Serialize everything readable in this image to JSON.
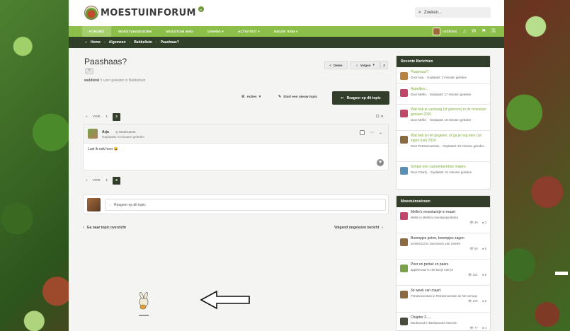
{
  "brand": {
    "name": "MOESTUINFORUM",
    "badge": "nl"
  },
  "search": {
    "placeholder": "Zoeken..."
  },
  "nav": {
    "items": [
      "FORUMS",
      "MOESTUINSEIZOEN",
      "MOESTUIN WIKI",
      "OVERIG",
      "ACTIVITEIT",
      "NIEUW ITEM"
    ],
    "user": "roddebra"
  },
  "breadcrumb": [
    "Home",
    "Algemeen",
    "Babbeltuin",
    "Paashaas?"
  ],
  "thread": {
    "title": "Paashaas?",
    "tag_button": "+",
    "author": "woldistel",
    "meta_rest": "5 uren geleden in Babbeltuin",
    "share": "Delen",
    "follow": "Volgen",
    "follow_count": "2",
    "actions": "Acties",
    "new_topic": "Start een nieuw topic",
    "reply": "Reageer op dit topic"
  },
  "pager": {
    "prev": "VOR.",
    "pages": [
      "1",
      "2"
    ],
    "current": "2"
  },
  "post": {
    "user": "Arja",
    "role": "Moderators",
    "time": "Geplaatst: 6 minuten geleden",
    "body": "Lust ik ook hoor 😄"
  },
  "quick_reply": {
    "placeholder": "Reageer op dit topic"
  },
  "bottom_nav": {
    "back": "Ga naar topic overzicht",
    "next": "Volgend ongelezen bericht"
  },
  "recent": {
    "heading": "Recente Berichten",
    "items": [
      {
        "title": "Paashaas?",
        "sub": "Door Arja, · Geplaatst: 2 minuten geleden"
      },
      {
        "title": "Appeltjes...",
        "sub": "Door Mellie, · Geplaatst: 17 minuten geleden"
      },
      {
        "title": "Wat heb je vandaag (of gisteren) in de moestuin gedaan 2026",
        "sub": "Door Mellie, · Geplaatst: 19 minuten geleden"
      },
      {
        "title": "Wat heb je net gegeten, of ga je nog eten (uit eigen tuin) 2026",
        "sub": "Door Petrasmoestuin, · Geplaatst: 19 minuten geleden"
      },
      {
        "title": "Simpel een camembert/brie maken.",
        "sub": "Door Charly, · Geplaatst: 41 minuten geleden"
      }
    ]
  },
  "season": {
    "heading": "Moestuinseizoen",
    "items": [
      {
        "title": "Mellie's moestuintje in maart",
        "sub": "Mellie in Mellie's moestuinperikelen",
        "views": "39",
        "comments": "3"
      },
      {
        "title": "Boompjes poten, boompjes zagen",
        "sub": "Jorieke123 in Seizoenen van Jorieke",
        "views": "58",
        "comments": "5"
      },
      {
        "title": "Peer en perkel en paars",
        "sub": "appelvrouw in Het boeje van jet",
        "views": "101",
        "comments": "9"
      },
      {
        "title": "3e week van maart",
        "sub": "Petrasmoestuin in Petrasmoestuin an het verloop",
        "views": "106",
        "comments": "8"
      },
      {
        "title": "Chapter 2.....",
        "sub": "Beukwood in Beukwood's Seizoen",
        "views": "77",
        "comments": "4"
      }
    ]
  },
  "colors": {
    "nav_green": "#8cbf4a",
    "dark_green": "#323d2a",
    "link_green": "#7fad3b"
  }
}
